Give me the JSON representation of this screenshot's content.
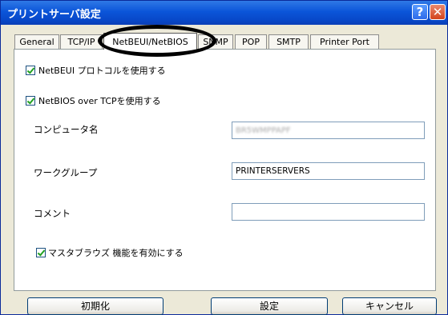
{
  "window": {
    "title": "プリントサーバ設定",
    "help_glyph": "?",
    "close_glyph": "✕"
  },
  "tabs": [
    {
      "label": "General"
    },
    {
      "label": "TCP/IP"
    },
    {
      "label": "NetBEUI/NetBIOS",
      "active": true
    },
    {
      "label": "SNMP"
    },
    {
      "label": "POP"
    },
    {
      "label": "SMTP"
    },
    {
      "label": "Printer Port"
    }
  ],
  "panel": {
    "netbeui_checkbox": {
      "label": "NetBEUI プロトコルを使用する",
      "checked": true
    },
    "netbios_checkbox": {
      "label": "NetBIOS over TCPを使用する",
      "checked": true
    },
    "computer_name": {
      "label": "コンピュータ名",
      "value": "BR5WMPPAPF"
    },
    "workgroup": {
      "label": "ワークグループ",
      "value": "PRINTERSERVERS"
    },
    "comment": {
      "label": "コメント",
      "value": ""
    },
    "master_browse_checkbox": {
      "label": "マスタブラウズ 機能を有効にする",
      "checked": true
    }
  },
  "buttons": {
    "reset": "初期化",
    "apply": "設定",
    "cancel": "キャンセル"
  },
  "colors": {
    "titlebar": "#0b55d9",
    "check": "#21a121",
    "highlight_ellipse": "#000000"
  }
}
